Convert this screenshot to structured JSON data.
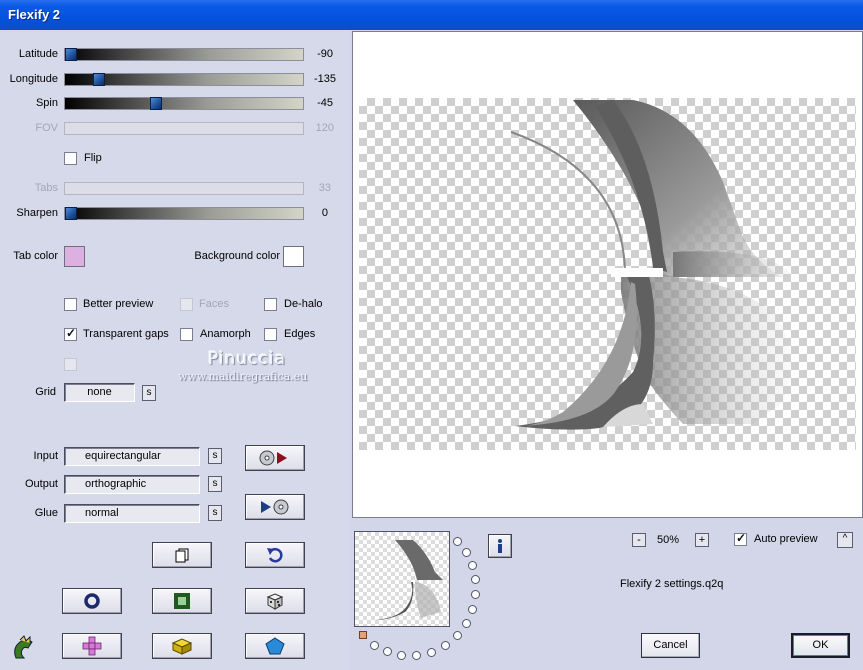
{
  "window": {
    "title": "Flexify 2"
  },
  "sliders": [
    {
      "label": "Latitude",
      "value": "-90",
      "fraction": 0.0,
      "enabled": true
    },
    {
      "label": "Longitude",
      "value": "-135",
      "fraction": 0.125,
      "enabled": true
    },
    {
      "label": "Spin",
      "value": "-45",
      "fraction": 0.375,
      "enabled": true
    },
    {
      "label": "FOV",
      "value": "120",
      "enabled": false
    },
    {
      "label": "Tabs",
      "value": "33",
      "enabled": false
    },
    {
      "label": "Sharpen",
      "value": "0",
      "fraction": 0.0,
      "enabled": true
    }
  ],
  "flip": {
    "label": "Flip",
    "checked": false
  },
  "colors": {
    "tab_label": "Tab color",
    "tab_value": "#dcb0e0",
    "background_label": "Background color",
    "background_value": "#ffffff"
  },
  "options": {
    "better_preview": {
      "label": "Better preview",
      "checked": false
    },
    "faces": {
      "label": "Faces",
      "checked": false,
      "enabled": false
    },
    "de_halo": {
      "label": "De-halo",
      "checked": false
    },
    "transparent_gaps": {
      "label": "Transparent gaps",
      "checked": true
    },
    "anamorph": {
      "label": "Anamorph",
      "checked": false
    },
    "edges": {
      "label": "Edges",
      "checked": false
    }
  },
  "grid": {
    "label": "Grid",
    "value": "none",
    "s": "s"
  },
  "watermark": {
    "line1": "Pinuccia",
    "line2": "www.maidiregrafica.eu"
  },
  "projection": {
    "input_label": "Input",
    "input_value": "equirectangular",
    "output_label": "Output",
    "output_value": "orthographic",
    "glue_label": "Glue",
    "glue_value": "normal",
    "s": "s"
  },
  "zoom": {
    "minus": "-",
    "value": "50%",
    "plus": "+"
  },
  "auto_preview": {
    "label": "Auto preview",
    "checked": true,
    "arrow": "^"
  },
  "settings_file": "Flexify 2 settings.q2q",
  "buttons": {
    "cancel": "Cancel",
    "ok": "OK"
  }
}
